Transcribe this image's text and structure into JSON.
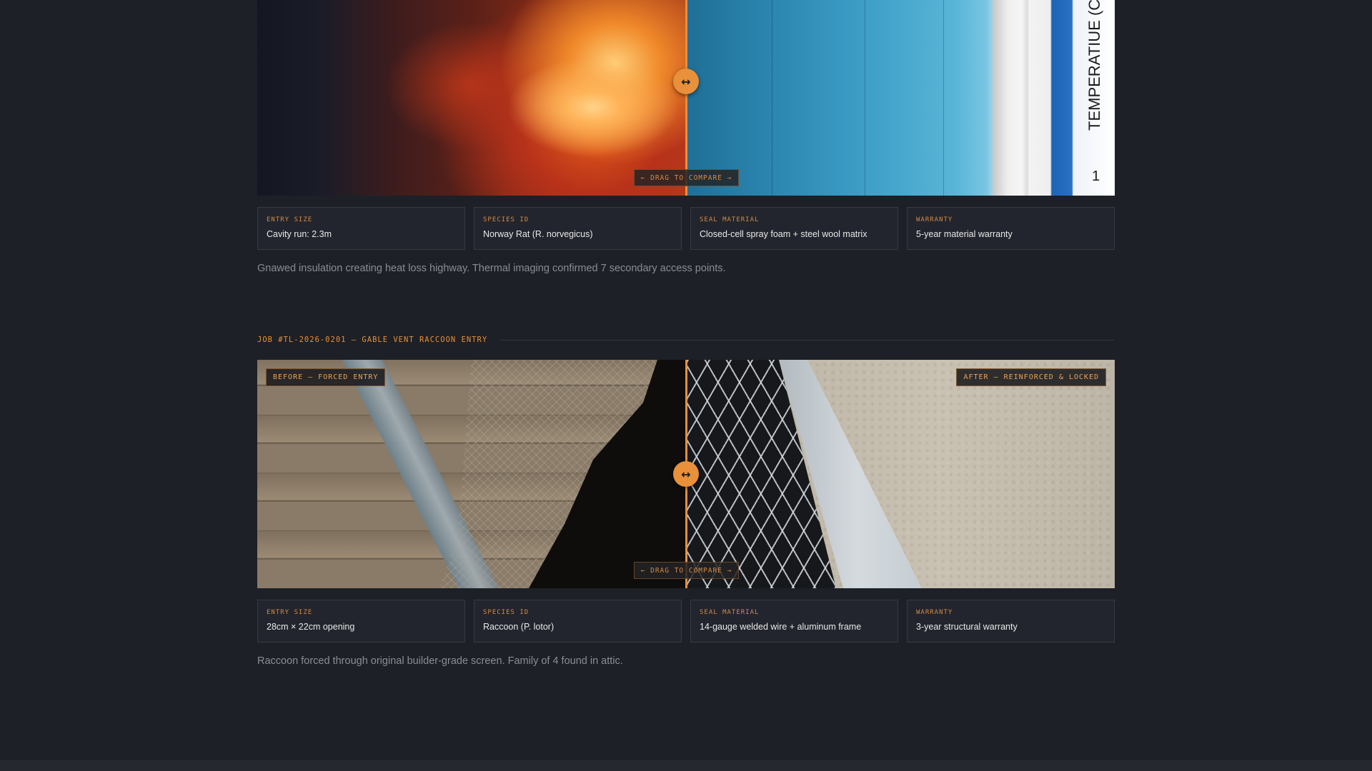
{
  "jobs": [
    {
      "title": "",
      "before_tag": "",
      "after_tag": "",
      "drag_hint": "← DRAG TO COMPARE →",
      "handle_icon": "↔",
      "thermal_scale_text": "TEMPERATIUE (C)",
      "thermal_scale_number": "1",
      "stats": [
        {
          "label": "ENTRY SIZE",
          "value": "Cavity run: 2.3m"
        },
        {
          "label": "SPECIES ID",
          "value": "Norway Rat (R. norvegicus)"
        },
        {
          "label": "SEAL MATERIAL",
          "value": "Closed-cell spray foam + steel wool matrix"
        },
        {
          "label": "WARRANTY",
          "value": "5-year material warranty"
        }
      ],
      "description": "Gnawed insulation creating heat loss highway. Thermal imaging confirmed 7 secondary access points."
    },
    {
      "title": "JOB #TL-2026-0201 — GABLE VENT RACCOON ENTRY",
      "before_tag": "BEFORE — FORCED ENTRY",
      "after_tag": "AFTER — REINFORCED & LOCKED",
      "drag_hint": "← DRAG TO COMPARE →",
      "handle_icon": "↔",
      "stats": [
        {
          "label": "ENTRY SIZE",
          "value": "28cm × 22cm opening"
        },
        {
          "label": "SPECIES ID",
          "value": "Raccoon (P. lotor)"
        },
        {
          "label": "SEAL MATERIAL",
          "value": "14-gauge welded wire + aluminum frame"
        },
        {
          "label": "WARRANTY",
          "value": "3-year structural warranty"
        }
      ],
      "description": "Raccoon forced through original builder-grade screen. Family of 4 found in attic."
    }
  ],
  "colors": {
    "background": "#1d2027",
    "accent": "#e8903a",
    "card": "#22252d",
    "muted_text": "#8a8d95"
  },
  "comparison": {
    "slider_position_fraction": 0.5
  }
}
